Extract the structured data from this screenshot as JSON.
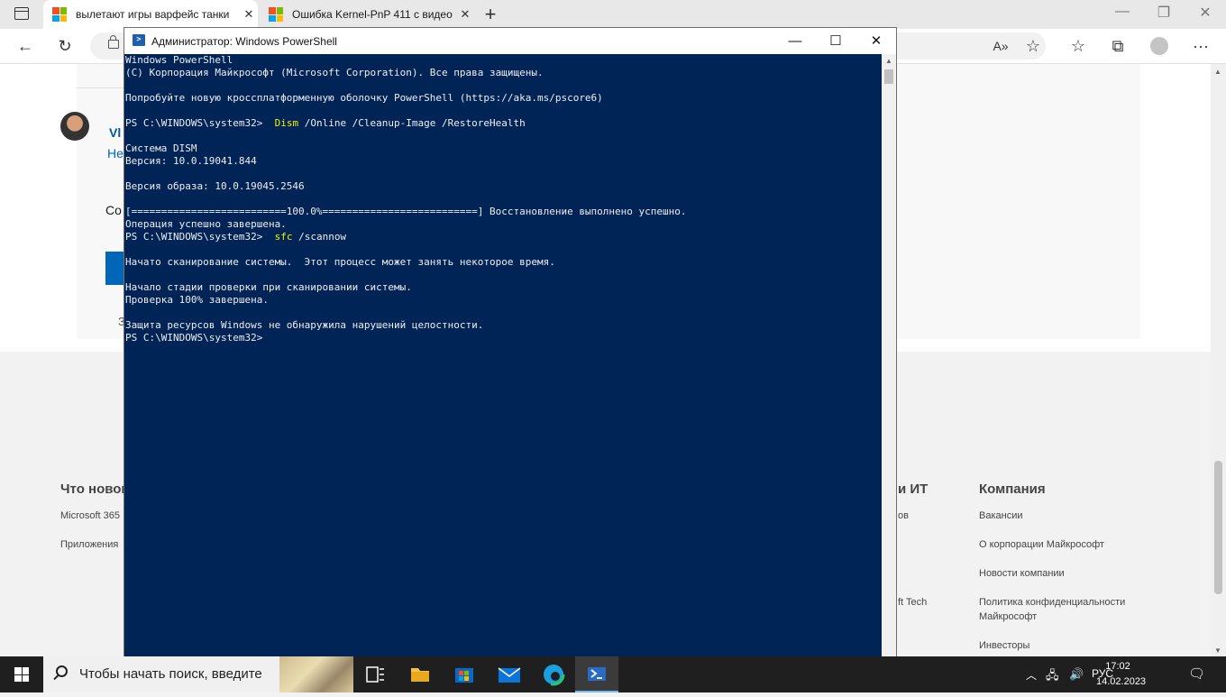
{
  "browser": {
    "tabs": [
      {
        "title": "вылетают игры варфейс танки",
        "close": "✕"
      },
      {
        "title": "Ошибка Kernel-PnP 411 с видео",
        "close": "✕"
      }
    ],
    "new_tab": "+",
    "window_controls": {
      "minimize": "—",
      "restore": "❐",
      "close": "✕"
    },
    "toolbar": {
      "back": "←",
      "refresh": "↻",
      "read_aloud": "A»",
      "add_favorite": "☆",
      "favorites": "☆",
      "collections": "⧉",
      "menu": "···"
    }
  },
  "page": {
    "author_name": "Vl",
    "author_sub": "Не",
    "content_text": "Со",
    "zoom_text": "З",
    "footer": {
      "col1": {
        "heading": "Что нового",
        "links": [
          "Microsoft 365",
          "Приложения"
        ]
      },
      "col2": {
        "heading": "и ИТ",
        "links": [
          "ов",
          "ft Tech"
        ]
      },
      "col3": {
        "heading": "Компания",
        "links": [
          "Вакансии",
          "О корпорации Майкрософт",
          "Новости компании",
          "Политика конфиденциальности Майкрософт",
          "Инвесторы"
        ]
      }
    }
  },
  "powershell": {
    "title": "Администратор: Windows PowerShell",
    "controls": {
      "minimize": "—",
      "maximize": "☐",
      "close": "✕"
    },
    "console": {
      "header1": "Windows PowerShell",
      "header2": "(C) Корпорация Майкрософт (Microsoft Corporation). Все права защищены.",
      "hint": "Попробуйте новую кроссплатформенную оболочку PowerShell (https://aka.ms/pscore6)",
      "prompt": "PS C:\\WINDOWS\\system32>",
      "cmd1_name": "Dism",
      "cmd1_args": "/Online /Cleanup-Image /RestoreHealth",
      "dism_title": "Система DISM",
      "dism_version": "Версия: 10.0.19041.844",
      "image_version": "Версия образа: 10.0.19045.2546",
      "progress": "[==========================100.0%==========================] Восстановление выполнено успешно.",
      "op_done": "Операция успешно завершена.",
      "cmd2_name": "sfc",
      "cmd2_args": "/scannow",
      "scan_start": "Начато сканирование системы.  Этот процесс может занять некоторое время.",
      "verify_start": "Начало стадии проверки при сканировании системы.",
      "verify_done": "Проверка 100% завершена.",
      "result": "Защита ресурсов Windows не обнаружила нарушений целостности."
    }
  },
  "taskbar": {
    "search_placeholder": "Чтобы начать поиск, введите",
    "language": "РУС",
    "time": "17:02",
    "date": "14.02.2023"
  }
}
